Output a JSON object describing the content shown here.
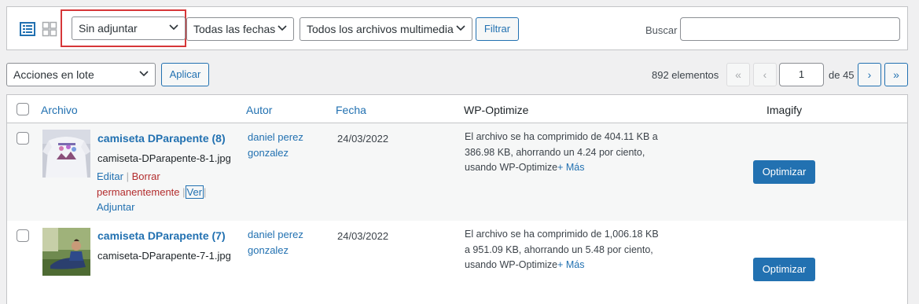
{
  "toolbar": {
    "view_list_icon": "list-view-icon",
    "view_grid_icon": "grid-view-icon",
    "attachment_filter": "Sin adjuntar",
    "date_filter": "Todas las fechas",
    "type_filter": "Todos los archivos multimedia",
    "filter_button": "Filtrar",
    "search_label": "Buscar",
    "search_value": ""
  },
  "bulk": {
    "action_select": "Acciones en lote",
    "apply_button": "Aplicar"
  },
  "pagination": {
    "count": "892 elementos",
    "first": "«",
    "prev": "‹",
    "current_page": "1",
    "of_label": "de 45",
    "next": "›",
    "last": "»"
  },
  "table": {
    "columns": {
      "file": "Archivo",
      "author": "Autor",
      "date": "Fecha",
      "wpo": "WP-Optimize",
      "imagify": "Imagify"
    },
    "rows": [
      {
        "title": "camiseta DParapente (8)",
        "filename": "camiseta-DParapente-8-1.jpg",
        "action_edit": "Editar",
        "action_delete": "Borrar permanentemente",
        "action_view": "Ver",
        "action_attach": "Adjuntar",
        "author": "daniel perez gonzalez",
        "date": "24/03/2022",
        "wpo_text": "El archivo se ha comprimido de 404.11 KB a 386.98 KB, ahorrando un 4.24 por ciento, usando WP-Optimize",
        "wpo_more": "+ Más",
        "imagify_button": "Optimizar"
      },
      {
        "title": "camiseta DParapente (7)",
        "filename": "camiseta-DParapente-7-1.jpg",
        "author": "daniel perez gonzalez",
        "date": "24/03/2022",
        "wpo_text": "El archivo se ha comprimido de 1,006.18 KB a 951.09 KB, ahorrando un 5.48 por ciento, usando WP-Optimize",
        "wpo_more": "+ Más",
        "imagify_button": "Optimizar"
      }
    ]
  },
  "colors": {
    "accent": "#2271b1",
    "danger": "#b32d2e",
    "highlight_outline": "#d63638"
  }
}
